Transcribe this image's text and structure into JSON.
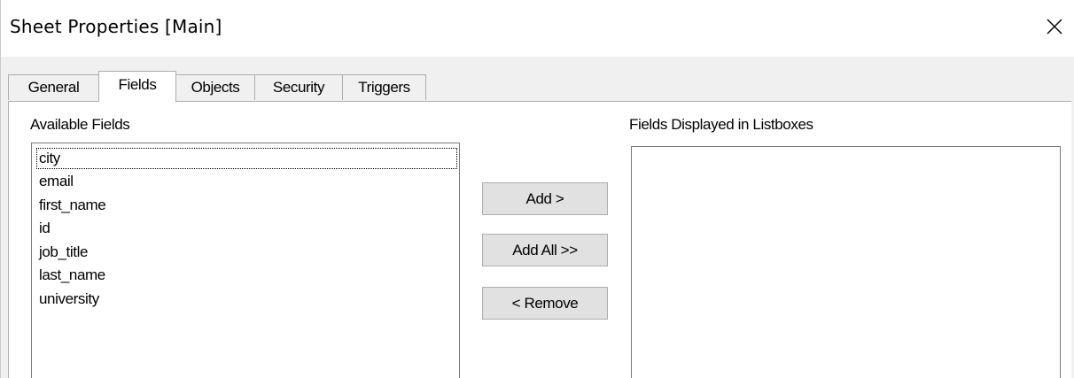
{
  "window": {
    "title": "Sheet Properties [Main]",
    "close_glyph": "✕"
  },
  "tabs": [
    {
      "label": "General",
      "active": false
    },
    {
      "label": "Fields",
      "active": true
    },
    {
      "label": "Objects",
      "active": false
    },
    {
      "label": "Security",
      "active": false
    },
    {
      "label": "Triggers",
      "active": false
    }
  ],
  "available_fields": {
    "label": "Available Fields",
    "items": [
      "city",
      "email",
      "first_name",
      "id",
      "job_title",
      "last_name",
      "university"
    ],
    "focused_item": "city"
  },
  "buttons": {
    "add": "Add >",
    "add_all": "Add All >>",
    "remove": "< Remove"
  },
  "displayed_fields": {
    "label": "Fields Displayed in Listboxes",
    "items": []
  },
  "colors": {
    "client_background": "#f0f0f0",
    "button_face": "#e1e1e1",
    "border": "#adadad"
  }
}
